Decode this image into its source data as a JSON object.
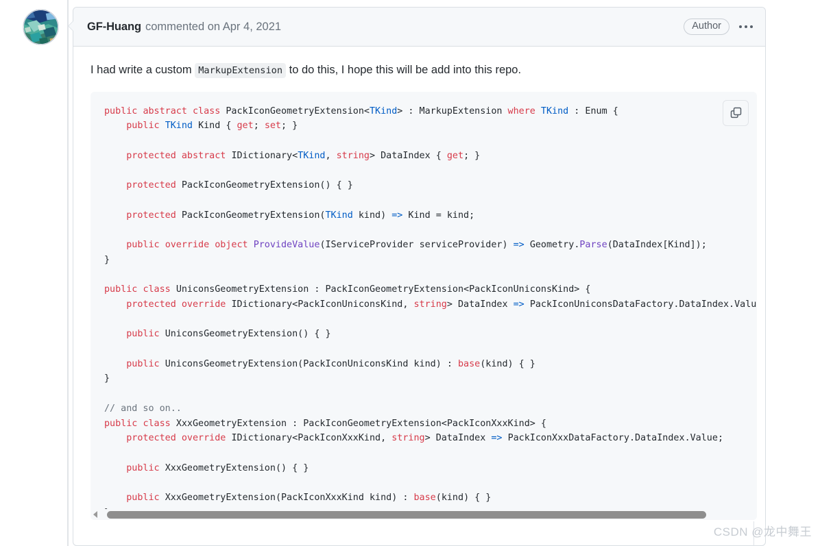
{
  "comment": {
    "author": "GF-Huang",
    "action_text": "commented on Apr 4, 2021",
    "author_badge": "Author",
    "menu_icon": "kebab-horizontal-icon",
    "avatar_alt": "avatar",
    "body_text_before": "I had write a custom",
    "body_inline_code": "MarkupExtension",
    "body_text_after": "to do this, I hope this will be add into this repo."
  },
  "code_block": {
    "copy_label": "copy-icon",
    "language": "csharp",
    "lines": [
      "public abstract class PackIconGeometryExtension<TKind> : MarkupExtension where TKind : Enum {",
      "    public TKind Kind { get; set; }",
      "",
      "    protected abstract IDictionary<TKind, string> DataIndex { get; }",
      "",
      "    protected PackIconGeometryExtension() { }",
      "",
      "    protected PackIconGeometryExtension(TKind kind) => Kind = kind;",
      "",
      "    public override object ProvideValue(IServiceProvider serviceProvider) => Geometry.Parse(DataIndex[Kind]);",
      "}",
      "",
      "public class UniconsGeometryExtension : PackIconGeometryExtension<PackIconUniconsKind> {",
      "    protected override IDictionary<PackIconUniconsKind, string> DataIndex => PackIconUniconsDataFactory.DataIndex.Value;",
      "",
      "    public UniconsGeometryExtension() { }",
      "",
      "    public UniconsGeometryExtension(PackIconUniconsKind kind) : base(kind) { }",
      "}",
      "",
      "// and so on..",
      "public class XxxGeometryExtension : PackIconGeometryExtension<PackIconXxxKind> {",
      "    protected override IDictionary<PackIconXxxKind, string> DataIndex => PackIconXxxDataFactory.DataIndex.Value;",
      "",
      "    public XxxGeometryExtension() { }",
      "",
      "    public XxxGeometryExtension(PackIconXxxKind kind) : base(kind) { }",
      "}"
    ]
  },
  "scrollbar": {
    "left_arrow": "triangle-left-icon",
    "position_percent": 0
  },
  "watermark": {
    "text": "CSDN @龙中舞王"
  },
  "colors": {
    "keyword": "#d73a49",
    "type": "#005cc5",
    "method": "#6f42c1",
    "comment": "#6a737d",
    "text": "#24292e",
    "code_bg": "#f6f8fa",
    "border": "#d9dee3"
  }
}
